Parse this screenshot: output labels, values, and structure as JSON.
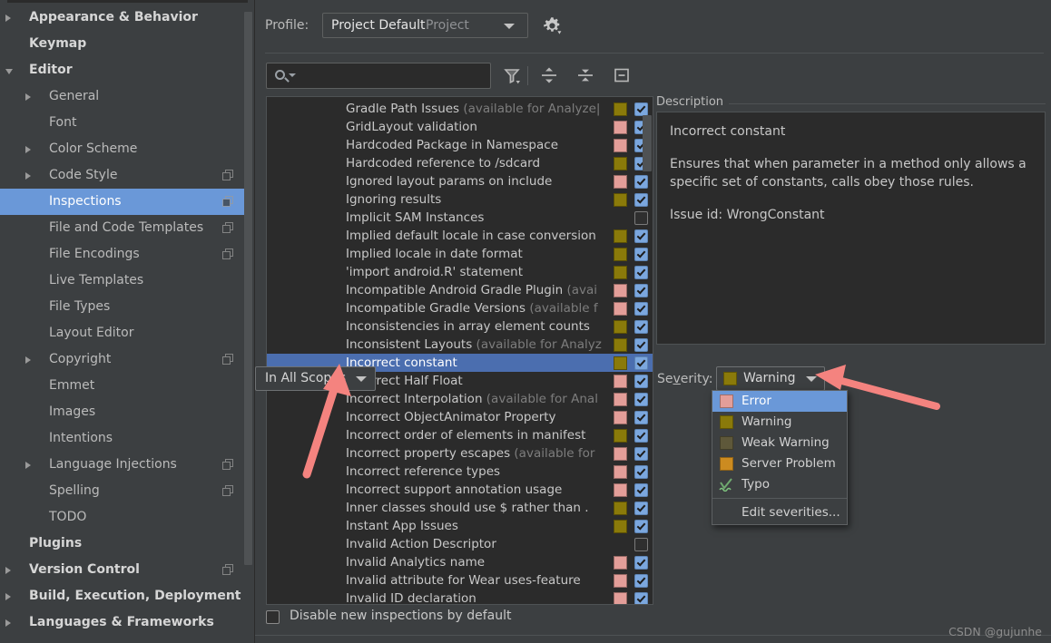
{
  "sidebar": {
    "items": [
      {
        "label": "Appearance & Behavior",
        "level": 0,
        "twisty": "collapsed",
        "copy": false,
        "selected": false
      },
      {
        "label": "Keymap",
        "level": 0,
        "twisty": "none",
        "copy": false,
        "selected": false
      },
      {
        "label": "Editor",
        "level": 0,
        "twisty": "expanded",
        "copy": false,
        "selected": false
      },
      {
        "label": "General",
        "level": 1,
        "twisty": "collapsed",
        "copy": false,
        "selected": false
      },
      {
        "label": "Font",
        "level": 1,
        "twisty": "none",
        "copy": false,
        "selected": false
      },
      {
        "label": "Color Scheme",
        "level": 1,
        "twisty": "collapsed",
        "copy": false,
        "selected": false
      },
      {
        "label": "Code Style",
        "level": 1,
        "twisty": "collapsed",
        "copy": true,
        "selected": false
      },
      {
        "label": "Inspections",
        "level": 1,
        "twisty": "none",
        "copy": true,
        "selected": true
      },
      {
        "label": "File and Code Templates",
        "level": 1,
        "twisty": "none",
        "copy": true,
        "selected": false
      },
      {
        "label": "File Encodings",
        "level": 1,
        "twisty": "none",
        "copy": true,
        "selected": false
      },
      {
        "label": "Live Templates",
        "level": 1,
        "twisty": "none",
        "copy": false,
        "selected": false
      },
      {
        "label": "File Types",
        "level": 1,
        "twisty": "none",
        "copy": false,
        "selected": false
      },
      {
        "label": "Layout Editor",
        "level": 1,
        "twisty": "none",
        "copy": false,
        "selected": false
      },
      {
        "label": "Copyright",
        "level": 1,
        "twisty": "collapsed",
        "copy": true,
        "selected": false
      },
      {
        "label": "Emmet",
        "level": 1,
        "twisty": "none",
        "copy": false,
        "selected": false
      },
      {
        "label": "Images",
        "level": 1,
        "twisty": "none",
        "copy": false,
        "selected": false
      },
      {
        "label": "Intentions",
        "level": 1,
        "twisty": "none",
        "copy": false,
        "selected": false
      },
      {
        "label": "Language Injections",
        "level": 1,
        "twisty": "collapsed",
        "copy": true,
        "selected": false
      },
      {
        "label": "Spelling",
        "level": 1,
        "twisty": "none",
        "copy": true,
        "selected": false
      },
      {
        "label": "TODO",
        "level": 1,
        "twisty": "none",
        "copy": false,
        "selected": false
      },
      {
        "label": "Plugins",
        "level": 0,
        "twisty": "none",
        "copy": false,
        "selected": false
      },
      {
        "label": "Version Control",
        "level": 0,
        "twisty": "collapsed",
        "copy": true,
        "selected": false
      },
      {
        "label": "Build, Execution, Deployment",
        "level": 0,
        "twisty": "collapsed",
        "copy": false,
        "selected": false
      },
      {
        "label": "Languages & Frameworks",
        "level": 0,
        "twisty": "collapsed",
        "copy": false,
        "selected": false
      }
    ]
  },
  "profile": {
    "label": "Profile:",
    "value": "Project Default",
    "scope_suffix": "Project",
    "gear_icon": "gear-icon"
  },
  "toolbar": {
    "search_value": "",
    "search_placeholder": "",
    "search_icon": "search-icon",
    "filter_icon": "filter-funnel-icon",
    "expand_icon": "expand-all-icon",
    "collapse_icon": "collapse-all-icon",
    "reset_icon": "minus-box-icon"
  },
  "colors": {
    "warning": "#8a7a0a",
    "error": "#e39e99",
    "weak_warning": "#5e583a",
    "server_problem": "#cc8b20",
    "selection_blue": "#4b6eaf",
    "menu_highlight": "#6a98d8",
    "arrow": "#f4837f",
    "checkbox_on": "#7ba7de"
  },
  "inspections": {
    "partial_top_row": true,
    "rows": [
      {
        "name": "Gradle Path Issues",
        "avail": " (available for Analyze|",
        "severity": "warning",
        "checked": true,
        "selected": false
      },
      {
        "name": "GridLayout validation",
        "avail": "",
        "severity": "error",
        "checked": true,
        "selected": false
      },
      {
        "name": "Hardcoded Package in Namespace",
        "avail": "",
        "severity": "error",
        "checked": true,
        "selected": false
      },
      {
        "name": "Hardcoded reference to /sdcard",
        "avail": "",
        "severity": "warning",
        "checked": true,
        "selected": false
      },
      {
        "name": "Ignored layout params on include",
        "avail": "",
        "severity": "error",
        "checked": true,
        "selected": false
      },
      {
        "name": "Ignoring results",
        "avail": "",
        "severity": "warning",
        "checked": true,
        "selected": false
      },
      {
        "name": "Implicit SAM Instances",
        "avail": "",
        "severity": "none",
        "checked": false,
        "selected": false
      },
      {
        "name": "Implied default locale in case conversion",
        "avail": "",
        "severity": "warning",
        "checked": true,
        "selected": false
      },
      {
        "name": "Implied locale in date format",
        "avail": "",
        "severity": "warning",
        "checked": true,
        "selected": false
      },
      {
        "name": "'import android.R' statement",
        "avail": "",
        "severity": "warning",
        "checked": true,
        "selected": false
      },
      {
        "name": "Incompatible Android Gradle Plugin",
        "avail": " (avai",
        "severity": "error",
        "checked": true,
        "selected": false
      },
      {
        "name": "Incompatible Gradle Versions",
        "avail": " (available f",
        "severity": "error",
        "checked": true,
        "selected": false
      },
      {
        "name": "Inconsistencies in array element counts",
        "avail": "",
        "severity": "warning",
        "checked": true,
        "selected": false
      },
      {
        "name": "Inconsistent Layouts",
        "avail": " (available for Analyz",
        "severity": "warning",
        "checked": true,
        "selected": false
      },
      {
        "name": "Incorrect constant",
        "avail": "",
        "severity": "warning",
        "checked": true,
        "selected": true
      },
      {
        "name": "Incorrect Half Float",
        "avail": "",
        "severity": "error",
        "checked": true,
        "selected": false
      },
      {
        "name": "Incorrect Interpolation",
        "avail": " (available for Anal",
        "severity": "error",
        "checked": true,
        "selected": false
      },
      {
        "name": "Incorrect ObjectAnimator Property",
        "avail": "",
        "severity": "error",
        "checked": true,
        "selected": false
      },
      {
        "name": "Incorrect order of elements in manifest",
        "avail": "",
        "severity": "warning",
        "checked": true,
        "selected": false
      },
      {
        "name": "Incorrect property escapes",
        "avail": " (available for",
        "severity": "error",
        "checked": true,
        "selected": false
      },
      {
        "name": "Incorrect reference types",
        "avail": "",
        "severity": "error",
        "checked": true,
        "selected": false
      },
      {
        "name": "Incorrect support annotation usage",
        "avail": "",
        "severity": "error",
        "checked": true,
        "selected": false
      },
      {
        "name": "Inner classes should use $ rather than .",
        "avail": "",
        "severity": "warning",
        "checked": true,
        "selected": false
      },
      {
        "name": "Instant App Issues",
        "avail": "",
        "severity": "warning",
        "checked": true,
        "selected": false
      },
      {
        "name": "Invalid Action Descriptor",
        "avail": "",
        "severity": "none",
        "checked": false,
        "selected": false
      },
      {
        "name": "Invalid Analytics name",
        "avail": "",
        "severity": "error",
        "checked": true,
        "selected": false
      },
      {
        "name": "Invalid attribute for Wear uses-feature",
        "avail": "",
        "severity": "error",
        "checked": true,
        "selected": false
      },
      {
        "name": "Invalid ID declaration",
        "avail": "",
        "severity": "error",
        "checked": true,
        "selected": false
      }
    ]
  },
  "description": {
    "title": "Description",
    "heading": "Incorrect constant",
    "body": "Ensures that when parameter in a method only allows a specific set of constants, calls obey those rules.",
    "issue_id": "Issue id: WrongConstant"
  },
  "severity": {
    "label": "Severity:",
    "value": "Warning",
    "scope_value": "In All Scopes",
    "menu": [
      {
        "label": "Error",
        "swatch": "#e39e99",
        "highlighted": true,
        "icon": "color-swatch"
      },
      {
        "label": "Warning",
        "swatch": "#8a7a0a",
        "highlighted": false,
        "icon": "color-swatch"
      },
      {
        "label": "Weak Warning",
        "swatch": "#5e583a",
        "highlighted": false,
        "icon": "color-swatch"
      },
      {
        "label": "Server Problem",
        "swatch": "#cc8b20",
        "highlighted": false,
        "icon": "color-swatch"
      },
      {
        "label": "Typo",
        "swatch": "",
        "highlighted": false,
        "icon": "typo-squiggle-icon"
      }
    ],
    "edit_label": "Edit severities..."
  },
  "footer": {
    "disable_label": "Disable new inspections by default",
    "disable_checked": false
  },
  "watermark": "CSDN @gujunhe"
}
